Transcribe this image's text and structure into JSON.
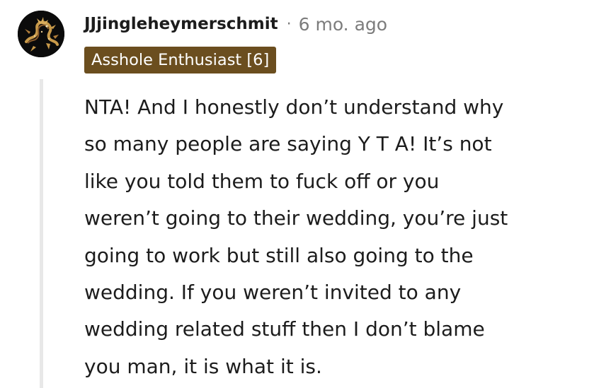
{
  "comment": {
    "author": "JJjingleheymerschmit",
    "separator": "·",
    "timestamp": "6 mo. ago",
    "flair": "Asshole Enthusiast [6]",
    "body_lines": [
      "NTA! And I honestly don’t understand why",
      "so many people are saying Y T A! It’s not",
      "like you told them to fuck off or you",
      "weren’t going to their wedding, you’re just",
      "going to work but still also going to the",
      "wedding. If you weren’t invited to any",
      "wedding related stuff then I don’t blame",
      "you man, it is what it is."
    ],
    "avatar_icon": "dragon-avatar-icon"
  },
  "colors": {
    "flair_bg": "#6b4e1f",
    "flair_text": "#ffffff",
    "meta_text": "#7c7c7c",
    "thread_line": "#e8e8e8"
  }
}
